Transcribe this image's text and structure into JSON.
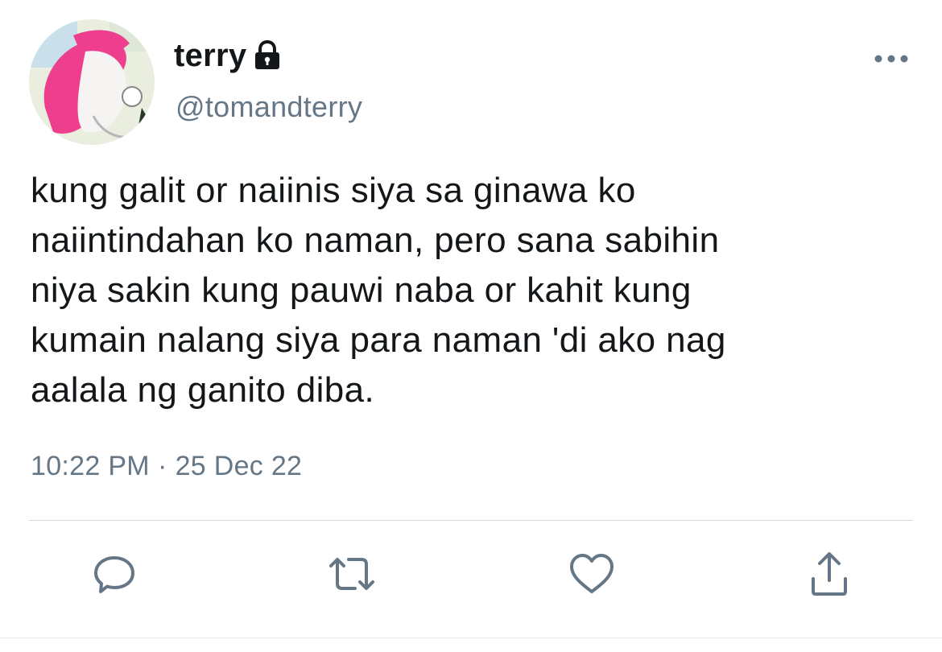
{
  "user": {
    "display_name": "terry",
    "handle": "@tomandterry",
    "protected_icon": "lock-icon",
    "avatar": "profile-avatar"
  },
  "tweet": {
    "text": "kung galit or naiinis siya sa ginawa ko\nnaiintindahan ko naman, pero sana sabihin\nniya sakin kung pauwi naba or kahit kung\nkumain nalang siya para naman 'di ako nag\naalala ng ganito diba.",
    "time": "10:22 PM",
    "separator": "·",
    "date": "25 Dec 22"
  },
  "actions": {
    "reply_icon": "reply-icon",
    "retweet_icon": "retweet-icon",
    "like_icon": "heart-icon",
    "share_icon": "share-icon",
    "more_icon": "more-icon"
  },
  "colors": {
    "text_primary": "#14171a",
    "text_secondary": "#657786",
    "icon": "#657786",
    "divider": "#d5dadf"
  }
}
